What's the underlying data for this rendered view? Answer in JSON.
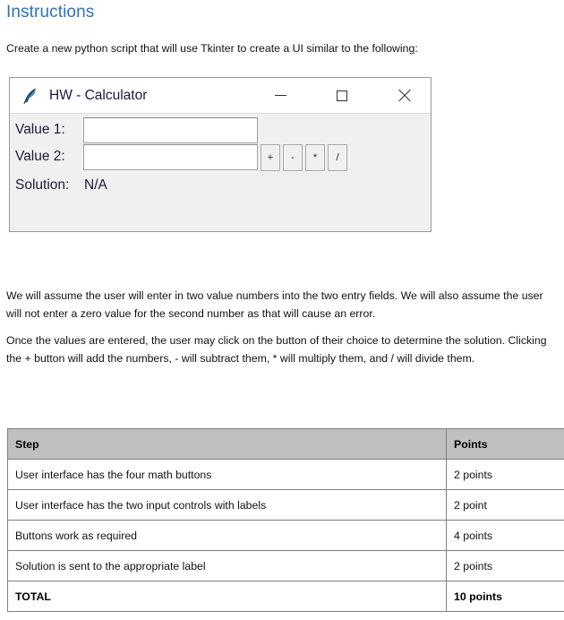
{
  "document": {
    "heading": "Instructions",
    "intro_paragraph": "Create a new python script that will use Tkinter to create a UI similar to the following:",
    "assumption_paragraph": "We will assume the user will enter in two value numbers into the two entry fields. We will also assume the user will not enter a zero value for the second number as that will cause an error.",
    "operations_paragraph": "Once the values are entered, the user may click on the button of their choice to determine the solution. Clicking the + button will add the numbers, - will subtract them, * will multiply them, and / will divide them.",
    "heading_color": "#2E74B5"
  },
  "calculator_window": {
    "title": "HW - Calculator",
    "icon": "feather-icon",
    "window_controls": {
      "minimize": "minimize-icon",
      "maximize": "maximize-icon",
      "close": "close-icon"
    },
    "fields": [
      {
        "label": "Value 1:",
        "value": "",
        "placeholder": ""
      },
      {
        "label": "Value 2:",
        "value": "",
        "placeholder": ""
      }
    ],
    "solution": {
      "label": "Solution:",
      "value": "N/A"
    },
    "operator_buttons": [
      {
        "label": "+",
        "name": "add"
      },
      {
        "label": "-",
        "name": "subtract"
      },
      {
        "label": "*",
        "name": "multiply"
      },
      {
        "label": "/",
        "name": "divide"
      }
    ]
  },
  "rubric": {
    "headers": [
      "Step",
      "Points"
    ],
    "rows": [
      {
        "step": "User interface has the four math buttons",
        "points": "2 points"
      },
      {
        "step": "User interface has the two input controls with labels",
        "points": "2 point"
      },
      {
        "step": "Buttons work as required",
        "points": "4 points"
      },
      {
        "step": "Solution is sent to the appropriate label",
        "points": "2 points"
      }
    ],
    "total": {
      "step": "TOTAL",
      "points": "10 points"
    }
  }
}
